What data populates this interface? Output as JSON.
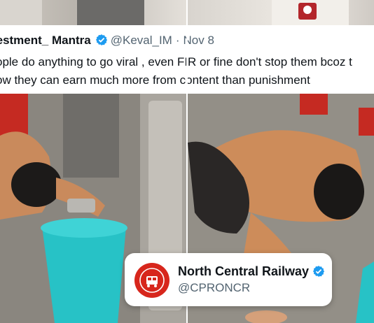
{
  "tweet": {
    "display_name": "restment_ Mantra",
    "handle": "@Keval_IM",
    "separator": "·",
    "date": "Nov 8",
    "line1": "ople do anything to go viral , even FIR or fine don't stop them bcoz t",
    "line2": "ow they can earn much more from content than punishment"
  },
  "quote": {
    "name": "North Central Railway",
    "handle": "@CPRONCR"
  },
  "colors": {
    "verified": "#1d9bf0",
    "rail_logo": "#d7261c",
    "bucket": "#27c2c6"
  }
}
